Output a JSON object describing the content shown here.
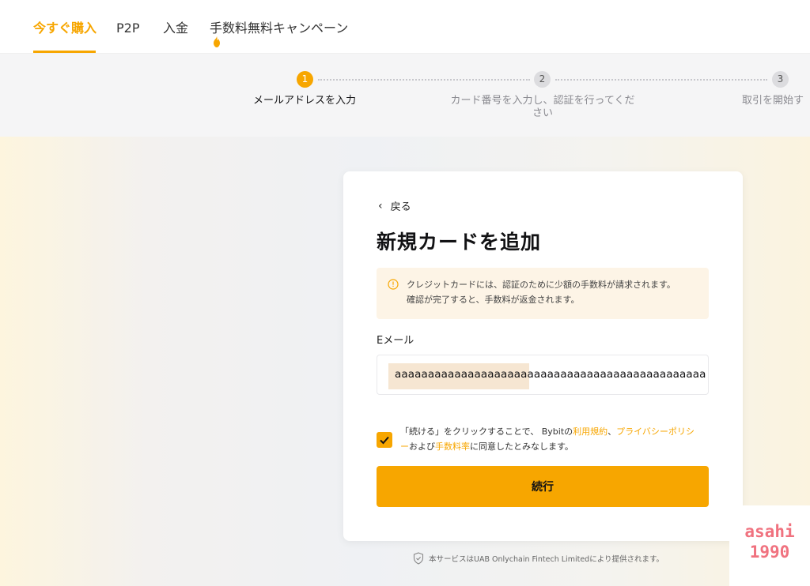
{
  "nav": {
    "tabs": [
      {
        "label": "今すぐ購入",
        "active": true
      },
      {
        "label": "P2P",
        "active": false
      },
      {
        "label": "入金",
        "active": false
      },
      {
        "label": "手数料無料キャンペーン",
        "active": false,
        "icon": "flame-icon"
      }
    ]
  },
  "stepper": {
    "steps": [
      {
        "number": "1",
        "label": "メールアドレスを入力",
        "active": true
      },
      {
        "number": "2",
        "label_line1": "カード番号を入力し、認証を行ってくだ",
        "label_line2": "さい",
        "active": false
      },
      {
        "number": "3",
        "label": "取引を開始す",
        "active": false
      }
    ]
  },
  "card": {
    "back_label": "戻る",
    "title": "新規カードを追加",
    "notice": {
      "icon": "warning-circle-icon",
      "line1": "クレジットカードには、認証のために少額の手数料が請求されます。",
      "line2": "確認が完了すると、手数料が返金されます。"
    },
    "email_label": "Eメール",
    "email_value": "aaaaaaaaaaaaaaaaaaaaaaaaaaaaaaaaaaaaaaaaaaaaaaa",
    "consent": {
      "checked": true,
      "prefix": "「続ける」をクリックすることで、 Bybitの",
      "terms_link": "利用規約",
      "sep": "、",
      "privacy_link": "プライバシーポリシー",
      "and": "および",
      "fees_link": "手数料率",
      "suffix": "に同意したとみなします。"
    },
    "continue_label": "続行"
  },
  "footer": {
    "icon": "shield-check-icon",
    "note": "本サービスはUAB Onlychain Fintech Limitedにより提供されます。"
  },
  "watermark": {
    "line1": "asahi",
    "line2": "1990"
  },
  "colors": {
    "accent": "#f7a600",
    "notice_bg": "#fdf4e6",
    "watermark": "#f0727f"
  }
}
